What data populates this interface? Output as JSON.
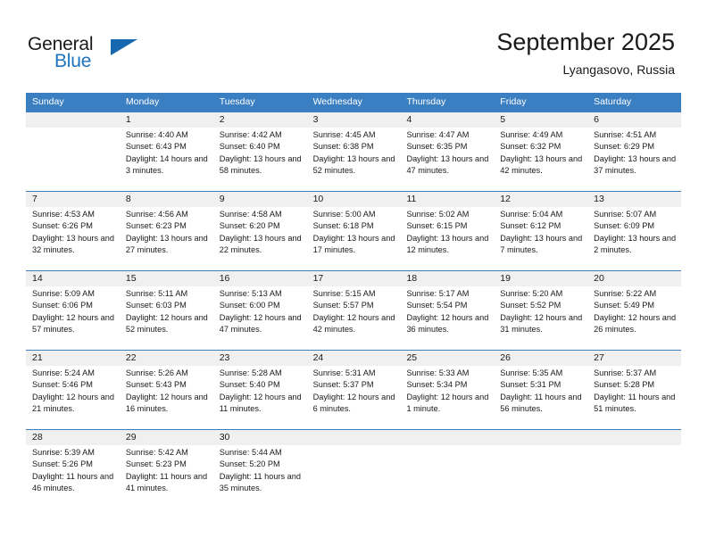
{
  "brand": {
    "name_top": "General",
    "name_bottom": "Blue",
    "accent_color": "#1666b0",
    "text_color": "#1a1a1a",
    "triangle_icon": "brand-triangle-icon"
  },
  "header": {
    "title": "September 2025",
    "subtitle": "Lyangasovo, Russia"
  },
  "colors": {
    "header_blue": "#3a7fc1",
    "datebar_gray": "#f0f0f0",
    "text": "#1a1a1a"
  },
  "weekdays": [
    "Sunday",
    "Monday",
    "Tuesday",
    "Wednesday",
    "Thursday",
    "Friday",
    "Saturday"
  ],
  "weeks": [
    {
      "days": [
        {
          "num": "",
          "sunrise": "",
          "sunset": "",
          "daylight": ""
        },
        {
          "num": "1",
          "sunrise": "Sunrise: 4:40 AM",
          "sunset": "Sunset: 6:43 PM",
          "daylight": "Daylight: 14 hours and 3 minutes."
        },
        {
          "num": "2",
          "sunrise": "Sunrise: 4:42 AM",
          "sunset": "Sunset: 6:40 PM",
          "daylight": "Daylight: 13 hours and 58 minutes."
        },
        {
          "num": "3",
          "sunrise": "Sunrise: 4:45 AM",
          "sunset": "Sunset: 6:38 PM",
          "daylight": "Daylight: 13 hours and 52 minutes."
        },
        {
          "num": "4",
          "sunrise": "Sunrise: 4:47 AM",
          "sunset": "Sunset: 6:35 PM",
          "daylight": "Daylight: 13 hours and 47 minutes."
        },
        {
          "num": "5",
          "sunrise": "Sunrise: 4:49 AM",
          "sunset": "Sunset: 6:32 PM",
          "daylight": "Daylight: 13 hours and 42 minutes."
        },
        {
          "num": "6",
          "sunrise": "Sunrise: 4:51 AM",
          "sunset": "Sunset: 6:29 PM",
          "daylight": "Daylight: 13 hours and 37 minutes."
        }
      ]
    },
    {
      "days": [
        {
          "num": "7",
          "sunrise": "Sunrise: 4:53 AM",
          "sunset": "Sunset: 6:26 PM",
          "daylight": "Daylight: 13 hours and 32 minutes."
        },
        {
          "num": "8",
          "sunrise": "Sunrise: 4:56 AM",
          "sunset": "Sunset: 6:23 PM",
          "daylight": "Daylight: 13 hours and 27 minutes."
        },
        {
          "num": "9",
          "sunrise": "Sunrise: 4:58 AM",
          "sunset": "Sunset: 6:20 PM",
          "daylight": "Daylight: 13 hours and 22 minutes."
        },
        {
          "num": "10",
          "sunrise": "Sunrise: 5:00 AM",
          "sunset": "Sunset: 6:18 PM",
          "daylight": "Daylight: 13 hours and 17 minutes."
        },
        {
          "num": "11",
          "sunrise": "Sunrise: 5:02 AM",
          "sunset": "Sunset: 6:15 PM",
          "daylight": "Daylight: 13 hours and 12 minutes."
        },
        {
          "num": "12",
          "sunrise": "Sunrise: 5:04 AM",
          "sunset": "Sunset: 6:12 PM",
          "daylight": "Daylight: 13 hours and 7 minutes."
        },
        {
          "num": "13",
          "sunrise": "Sunrise: 5:07 AM",
          "sunset": "Sunset: 6:09 PM",
          "daylight": "Daylight: 13 hours and 2 minutes."
        }
      ]
    },
    {
      "days": [
        {
          "num": "14",
          "sunrise": "Sunrise: 5:09 AM",
          "sunset": "Sunset: 6:06 PM",
          "daylight": "Daylight: 12 hours and 57 minutes."
        },
        {
          "num": "15",
          "sunrise": "Sunrise: 5:11 AM",
          "sunset": "Sunset: 6:03 PM",
          "daylight": "Daylight: 12 hours and 52 minutes."
        },
        {
          "num": "16",
          "sunrise": "Sunrise: 5:13 AM",
          "sunset": "Sunset: 6:00 PM",
          "daylight": "Daylight: 12 hours and 47 minutes."
        },
        {
          "num": "17",
          "sunrise": "Sunrise: 5:15 AM",
          "sunset": "Sunset: 5:57 PM",
          "daylight": "Daylight: 12 hours and 42 minutes."
        },
        {
          "num": "18",
          "sunrise": "Sunrise: 5:17 AM",
          "sunset": "Sunset: 5:54 PM",
          "daylight": "Daylight: 12 hours and 36 minutes."
        },
        {
          "num": "19",
          "sunrise": "Sunrise: 5:20 AM",
          "sunset": "Sunset: 5:52 PM",
          "daylight": "Daylight: 12 hours and 31 minutes."
        },
        {
          "num": "20",
          "sunrise": "Sunrise: 5:22 AM",
          "sunset": "Sunset: 5:49 PM",
          "daylight": "Daylight: 12 hours and 26 minutes."
        }
      ]
    },
    {
      "days": [
        {
          "num": "21",
          "sunrise": "Sunrise: 5:24 AM",
          "sunset": "Sunset: 5:46 PM",
          "daylight": "Daylight: 12 hours and 21 minutes."
        },
        {
          "num": "22",
          "sunrise": "Sunrise: 5:26 AM",
          "sunset": "Sunset: 5:43 PM",
          "daylight": "Daylight: 12 hours and 16 minutes."
        },
        {
          "num": "23",
          "sunrise": "Sunrise: 5:28 AM",
          "sunset": "Sunset: 5:40 PM",
          "daylight": "Daylight: 12 hours and 11 minutes."
        },
        {
          "num": "24",
          "sunrise": "Sunrise: 5:31 AM",
          "sunset": "Sunset: 5:37 PM",
          "daylight": "Daylight: 12 hours and 6 minutes."
        },
        {
          "num": "25",
          "sunrise": "Sunrise: 5:33 AM",
          "sunset": "Sunset: 5:34 PM",
          "daylight": "Daylight: 12 hours and 1 minute."
        },
        {
          "num": "26",
          "sunrise": "Sunrise: 5:35 AM",
          "sunset": "Sunset: 5:31 PM",
          "daylight": "Daylight: 11 hours and 56 minutes."
        },
        {
          "num": "27",
          "sunrise": "Sunrise: 5:37 AM",
          "sunset": "Sunset: 5:28 PM",
          "daylight": "Daylight: 11 hours and 51 minutes."
        }
      ]
    },
    {
      "days": [
        {
          "num": "28",
          "sunrise": "Sunrise: 5:39 AM",
          "sunset": "Sunset: 5:26 PM",
          "daylight": "Daylight: 11 hours and 46 minutes."
        },
        {
          "num": "29",
          "sunrise": "Sunrise: 5:42 AM",
          "sunset": "Sunset: 5:23 PM",
          "daylight": "Daylight: 11 hours and 41 minutes."
        },
        {
          "num": "30",
          "sunrise": "Sunrise: 5:44 AM",
          "sunset": "Sunset: 5:20 PM",
          "daylight": "Daylight: 11 hours and 35 minutes."
        },
        {
          "num": "",
          "sunrise": "",
          "sunset": "",
          "daylight": ""
        },
        {
          "num": "",
          "sunrise": "",
          "sunset": "",
          "daylight": ""
        },
        {
          "num": "",
          "sunrise": "",
          "sunset": "",
          "daylight": ""
        },
        {
          "num": "",
          "sunrise": "",
          "sunset": "",
          "daylight": ""
        }
      ]
    }
  ]
}
